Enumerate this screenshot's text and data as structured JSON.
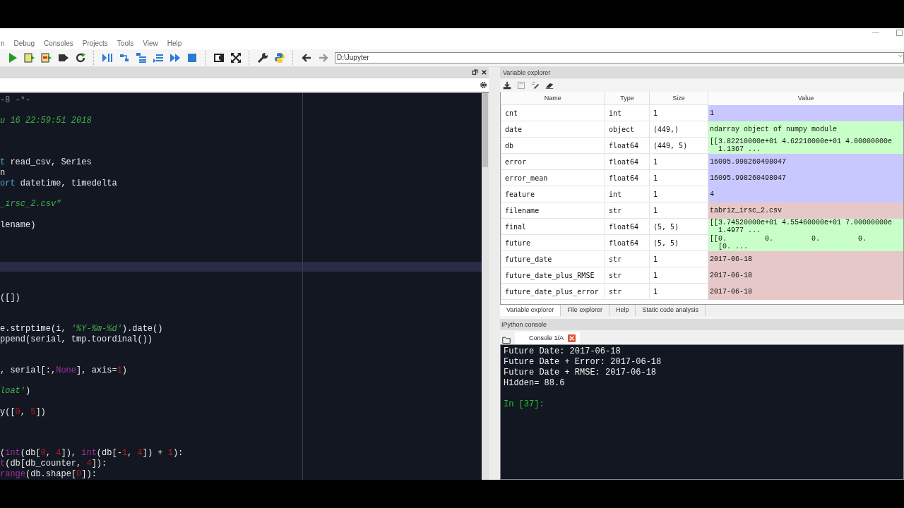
{
  "window": {
    "controls": [
      "—"
    ]
  },
  "menu": [
    "n",
    "Debug",
    "Consoles",
    "Projects",
    "Tools",
    "View",
    "Help"
  ],
  "toolbar": {
    "path": "D:\\Jupyter"
  },
  "editor": {
    "lines": [
      {
        "kind": "code",
        "tokens": [
          {
            "text": "-8 -*-",
            "kind": "comment"
          }
        ]
      },
      {
        "kind": "blank"
      },
      {
        "kind": "code",
        "tokens": [
          {
            "text": "u 16 22:59:51 2018",
            "kind": "string"
          }
        ]
      },
      {
        "kind": "blank"
      },
      {
        "kind": "blank"
      },
      {
        "kind": "blank"
      },
      {
        "kind": "code",
        "tokens": [
          {
            "text": "t",
            "kind": "keyword"
          },
          {
            "text": " read_csv, Series",
            "kind": "plain"
          }
        ]
      },
      {
        "kind": "code",
        "tokens": [
          {
            "text": "n",
            "kind": "plain"
          }
        ]
      },
      {
        "kind": "code",
        "tokens": [
          {
            "text": "ort",
            "kind": "keyword"
          },
          {
            "text": " datetime, timedelta",
            "kind": "plain"
          }
        ]
      },
      {
        "kind": "blank"
      },
      {
        "kind": "code",
        "tokens": [
          {
            "text": "_irsc_2.csv\"",
            "kind": "string"
          }
        ]
      },
      {
        "kind": "blank"
      },
      {
        "kind": "code",
        "tokens": [
          {
            "text": "lename)",
            "kind": "plain"
          }
        ]
      },
      {
        "kind": "blank"
      },
      {
        "kind": "blank"
      },
      {
        "kind": "blank"
      },
      {
        "kind": "current"
      },
      {
        "kind": "blank"
      },
      {
        "kind": "blank"
      },
      {
        "kind": "code",
        "tokens": [
          {
            "text": "([])",
            "kind": "plain"
          }
        ]
      },
      {
        "kind": "blank"
      },
      {
        "kind": "blank"
      },
      {
        "kind": "code",
        "tokens": [
          {
            "text": "e.strptime(i, ",
            "kind": "plain"
          },
          {
            "text": "'%Y-%m-%d'",
            "kind": "string"
          },
          {
            "text": ").date()",
            "kind": "plain"
          }
        ]
      },
      {
        "kind": "code",
        "tokens": [
          {
            "text": "ppend(serial, tmp.toordinal())",
            "kind": "plain"
          }
        ]
      },
      {
        "kind": "blank"
      },
      {
        "kind": "blank"
      },
      {
        "kind": "code",
        "tokens": [
          {
            "text": ", serial[:,",
            "kind": "plain"
          },
          {
            "text": "None",
            "kind": "builtin"
          },
          {
            "text": "], axis=",
            "kind": "plain"
          },
          {
            "text": "1",
            "kind": "number"
          },
          {
            "text": ")",
            "kind": "plain"
          }
        ]
      },
      {
        "kind": "blank"
      },
      {
        "kind": "code",
        "tokens": [
          {
            "text": "loat'",
            "kind": "string"
          },
          {
            "text": ")",
            "kind": "plain"
          }
        ]
      },
      {
        "kind": "blank"
      },
      {
        "kind": "code",
        "tokens": [
          {
            "text": "y([",
            "kind": "plain"
          },
          {
            "text": "0",
            "kind": "number"
          },
          {
            "text": ", ",
            "kind": "plain"
          },
          {
            "text": "5",
            "kind": "number"
          },
          {
            "text": "])",
            "kind": "plain"
          }
        ]
      },
      {
        "kind": "blank"
      },
      {
        "kind": "blank"
      },
      {
        "kind": "blank"
      },
      {
        "kind": "code",
        "tokens": [
          {
            "text": "(",
            "kind": "plain"
          },
          {
            "text": "int",
            "kind": "builtin"
          },
          {
            "text": "(db[",
            "kind": "plain"
          },
          {
            "text": "0",
            "kind": "number"
          },
          {
            "text": ", ",
            "kind": "plain"
          },
          {
            "text": "4",
            "kind": "number"
          },
          {
            "text": "]), ",
            "kind": "plain"
          },
          {
            "text": "int",
            "kind": "builtin"
          },
          {
            "text": "(db[-",
            "kind": "plain"
          },
          {
            "text": "1",
            "kind": "number"
          },
          {
            "text": ", ",
            "kind": "plain"
          },
          {
            "text": "4",
            "kind": "number"
          },
          {
            "text": "]) + ",
            "kind": "plain"
          },
          {
            "text": "1",
            "kind": "number"
          },
          {
            "text": "):",
            "kind": "plain"
          }
        ]
      },
      {
        "kind": "code",
        "tokens": [
          {
            "text": "t",
            "kind": "builtin"
          },
          {
            "text": "(db[db_counter, ",
            "kind": "plain"
          },
          {
            "text": "4",
            "kind": "number"
          },
          {
            "text": "]):",
            "kind": "plain"
          }
        ]
      },
      {
        "kind": "code",
        "tokens": [
          {
            "text": "range",
            "kind": "builtin"
          },
          {
            "text": "(db.shape[",
            "kind": "plain"
          },
          {
            "text": "0",
            "kind": "number"
          },
          {
            "text": "]):",
            "kind": "plain"
          }
        ]
      }
    ]
  },
  "variable_explorer": {
    "title": "Variable explorer",
    "columns": [
      "Name",
      "Type",
      "Size",
      "Value"
    ],
    "rows": [
      {
        "name": "cnt",
        "type": "int",
        "size": "1",
        "value": [
          "1"
        ],
        "color": "#c8c8ff"
      },
      {
        "name": "date",
        "type": "object",
        "size": "(449,)",
        "value": [
          "ndarray object of numpy module"
        ],
        "color": "#c8ffc8"
      },
      {
        "name": "db",
        "type": "float64",
        "size": "(449, 5)",
        "value": [
          "[[3.82210000e+01 4.62210000e+01 4.00000000e",
          "  1.1367 ..."
        ],
        "color": "#c8ffc8"
      },
      {
        "name": "error",
        "type": "float64",
        "size": "1",
        "value": [
          "16095.998260498047"
        ],
        "color": "#c8c8ff"
      },
      {
        "name": "error_mean",
        "type": "float64",
        "size": "1",
        "value": [
          "16095.998260498047"
        ],
        "color": "#c8c8ff"
      },
      {
        "name": "feature",
        "type": "int",
        "size": "1",
        "value": [
          "4"
        ],
        "color": "#c8c8ff"
      },
      {
        "name": "filename",
        "type": "str",
        "size": "1",
        "value": [
          "tabriz_irsc_2.csv"
        ],
        "color": "#e6c8c8"
      },
      {
        "name": "final",
        "type": "float64",
        "size": "(5, 5)",
        "value": [
          "[[3.74520000e+01 4.55460000e+01 7.00000000e",
          "  1.4977 ..."
        ],
        "color": "#c8ffc8"
      },
      {
        "name": "future",
        "type": "float64",
        "size": "(5, 5)",
        "value": [
          "[[0.         0.         0.         0.",
          "  [0. ..."
        ],
        "color": "#c8ffc8"
      },
      {
        "name": "future_date",
        "type": "str",
        "size": "1",
        "value": [
          "2017-06-18"
        ],
        "color": "#e6c8c8"
      },
      {
        "name": "future_date_plus_RMSE",
        "type": "str",
        "size": "1",
        "value": [
          "2017-06-18"
        ],
        "color": "#e6c8c8"
      },
      {
        "name": "future_date_plus_error",
        "type": "str",
        "size": "1",
        "value": [
          "2017-06-18"
        ],
        "color": "#e6c8c8"
      }
    ]
  },
  "pane_tabs": [
    {
      "label": "Variable explorer",
      "selected": true
    },
    {
      "label": "File explorer",
      "selected": false
    },
    {
      "label": "Help",
      "selected": false
    },
    {
      "label": "Static code analysis",
      "selected": false
    }
  ],
  "console": {
    "title": "IPython console",
    "tabs": [
      {
        "label": "Console 1/A",
        "selected": true
      }
    ],
    "lines": [
      {
        "kind": "output",
        "text": "Future Date: 2017-06-18"
      },
      {
        "kind": "output",
        "text": "Future Date + Error: 2017-06-18"
      },
      {
        "kind": "output",
        "text": "Future Date + RMSE: 2017-06-18"
      },
      {
        "kind": "output",
        "text": "Hidden= 88.6"
      },
      {
        "kind": "blank"
      },
      {
        "kind": "prompt",
        "text": "In [37]:"
      }
    ]
  }
}
